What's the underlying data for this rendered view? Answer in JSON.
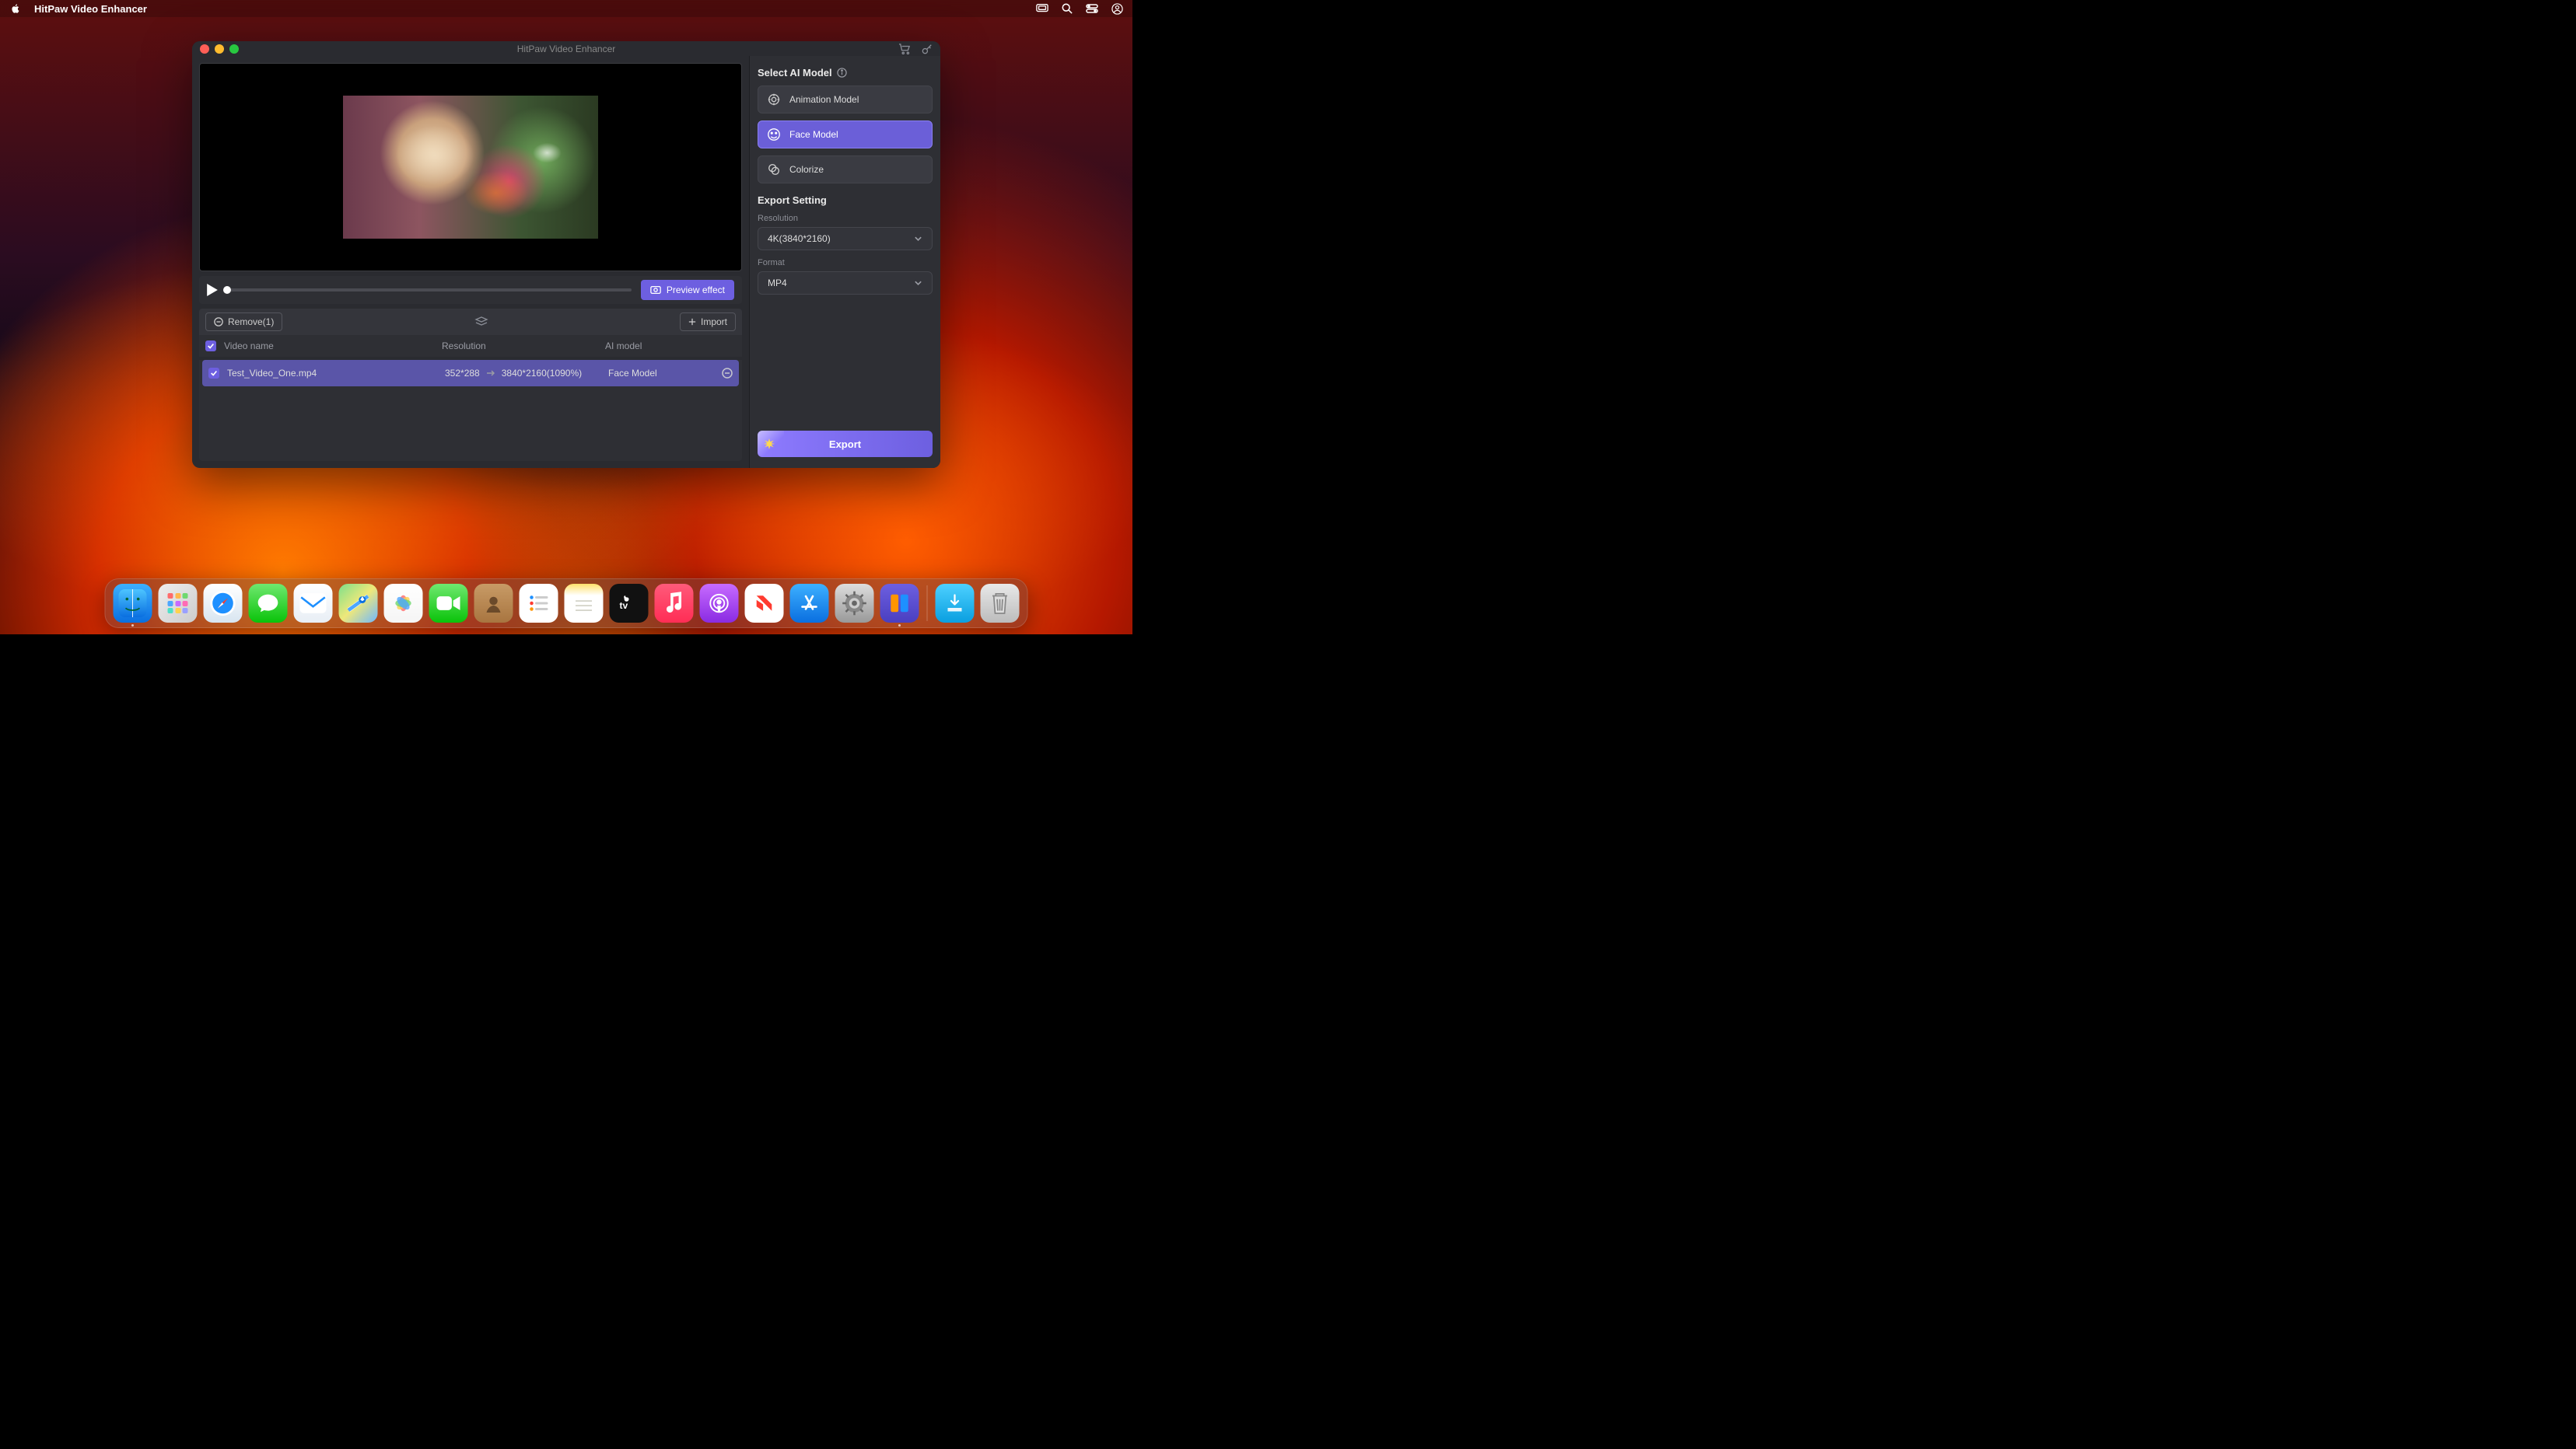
{
  "menubar": {
    "app_name": "HitPaw Video Enhancer"
  },
  "window": {
    "title": "HitPaw Video Enhancer"
  },
  "player": {
    "preview_label": "Preview effect"
  },
  "toolbar": {
    "remove_label": "Remove(1)",
    "import_label": "Import"
  },
  "list": {
    "headers": {
      "name": "Video name",
      "resolution": "Resolution",
      "model": "AI model"
    },
    "row": {
      "name": "Test_Video_One.mp4",
      "src_res": "352*288",
      "dst_res": "3840*2160(1090%)",
      "model": "Face Model"
    }
  },
  "side": {
    "model_header": "Select AI Model",
    "models": {
      "animation": "Animation Model",
      "face": "Face Model",
      "colorize": "Colorize"
    },
    "export_header": "Export Setting",
    "resolution_label": "Resolution",
    "resolution_value": "4K(3840*2160)",
    "format_label": "Format",
    "format_value": "MP4",
    "export_btn": "Export"
  },
  "dock": {
    "apps": [
      {
        "id": "finder",
        "name": "Finder",
        "running": true
      },
      {
        "id": "launchpad",
        "name": "Launchpad"
      },
      {
        "id": "safari",
        "name": "Safari"
      },
      {
        "id": "messages",
        "name": "Messages"
      },
      {
        "id": "mail",
        "name": "Mail"
      },
      {
        "id": "maps",
        "name": "Maps"
      },
      {
        "id": "photos",
        "name": "Photos"
      },
      {
        "id": "facetime",
        "name": "FaceTime"
      },
      {
        "id": "contacts",
        "name": "Contacts"
      },
      {
        "id": "reminders",
        "name": "Reminders"
      },
      {
        "id": "notes",
        "name": "Notes"
      },
      {
        "id": "tv",
        "name": "TV"
      },
      {
        "id": "music",
        "name": "Music"
      },
      {
        "id": "podcasts",
        "name": "Podcasts"
      },
      {
        "id": "news",
        "name": "News"
      },
      {
        "id": "appstore",
        "name": "App Store"
      },
      {
        "id": "settings",
        "name": "System Settings"
      },
      {
        "id": "hitpaw",
        "name": "HitPaw Video Enhancer",
        "running": true
      }
    ]
  }
}
